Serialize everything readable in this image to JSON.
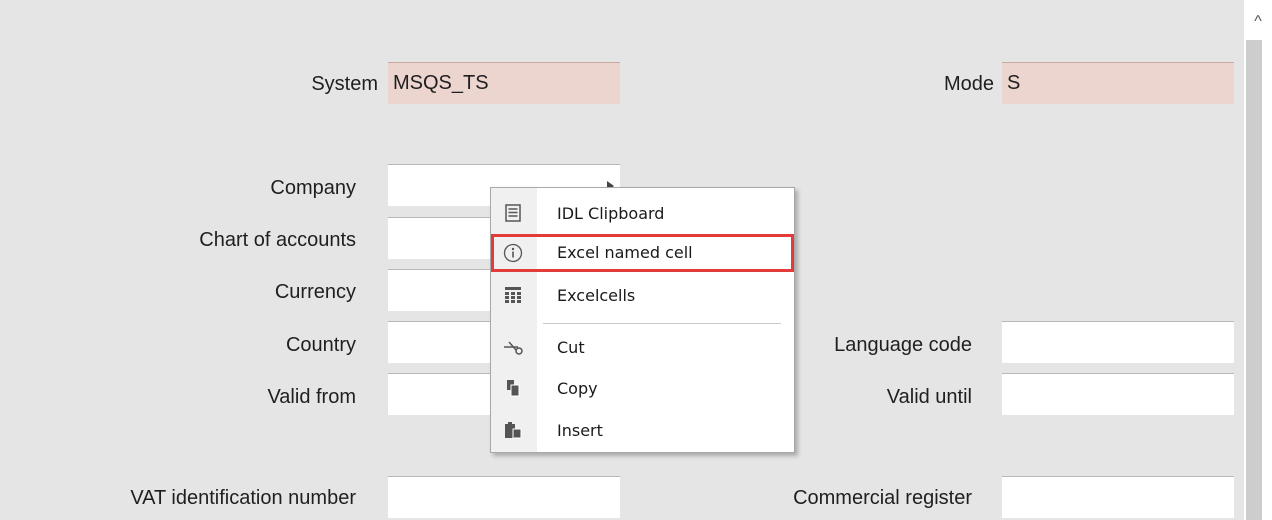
{
  "form": {
    "system": {
      "label": "System",
      "value": "MSQS_TS"
    },
    "mode": {
      "label": "Mode",
      "value": "S"
    },
    "company": {
      "label": "Company",
      "value": ""
    },
    "chart_of_accounts": {
      "label": "Chart of accounts",
      "value": ""
    },
    "currency": {
      "label": "Currency",
      "value": ""
    },
    "country": {
      "label": "Country",
      "value": ""
    },
    "language_code": {
      "label": "Language code",
      "value": ""
    },
    "valid_from": {
      "label": "Valid from",
      "value": ""
    },
    "valid_until": {
      "label": "Valid until",
      "value": ""
    },
    "vat_id": {
      "label": "VAT identification number",
      "value": ""
    },
    "commercial_register": {
      "label": "Commercial register",
      "value": ""
    }
  },
  "context_menu": {
    "items": [
      {
        "label": "IDL Clipboard",
        "icon": "list-icon"
      },
      {
        "label": "Excel named cell",
        "icon": "info-icon",
        "highlighted": true
      },
      {
        "label": "Excelcells",
        "icon": "grid-icon"
      },
      {
        "label": "Cut",
        "icon": "scissors-icon"
      },
      {
        "label": "Copy",
        "icon": "copy-icon"
      },
      {
        "label": "Insert",
        "icon": "paste-icon"
      }
    ]
  },
  "colors": {
    "readonly_field": "#ecd4cf",
    "highlight": "#e33a3a",
    "background": "#e5e5e5"
  },
  "scrollbar": {
    "up_glyph": "^"
  }
}
